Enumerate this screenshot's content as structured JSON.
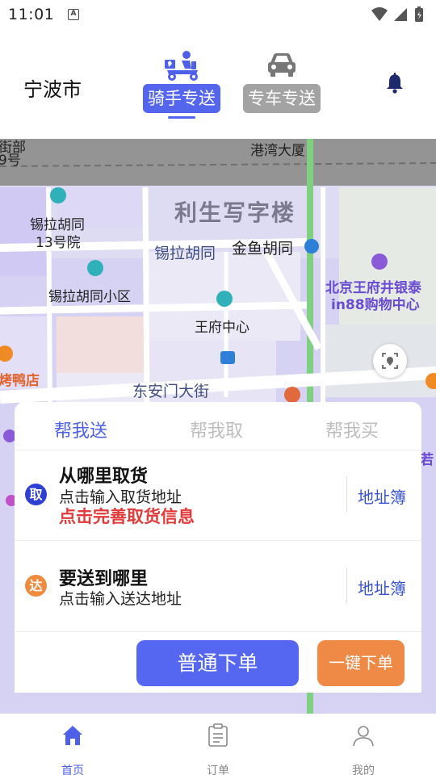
{
  "status_bar": {
    "time": "11:01"
  },
  "header": {
    "city": "宁波市",
    "modes": [
      {
        "label": "骑手专送",
        "icon": "rider-scooter-icon",
        "active": true
      },
      {
        "label": "专车专送",
        "icon": "car-icon",
        "active": false
      }
    ],
    "notification_icon": "bell-icon"
  },
  "map": {
    "labels": {
      "top_left_a": "街部",
      "top_left_b": "9号",
      "top_hotel": "港湾大厦",
      "building": "利生写字楼",
      "poi_xila13_a": "锡拉胡同",
      "poi_xila13_b": "13号院",
      "road_xila": "锡拉胡同",
      "road_jinyu": "金鱼胡同",
      "poi_xila_xiaoqu": "锡拉胡同小区",
      "poi_wangfu": "王府中心",
      "mall_a": "北京王府井银泰",
      "mall_b": "in88购物中心",
      "restaurant": "烤鸭店",
      "road_dongan": "东安门大街",
      "right_edge": "若"
    }
  },
  "order_card": {
    "tabs": [
      {
        "label": "帮我送",
        "active": true
      },
      {
        "label": "帮我取",
        "active": false
      },
      {
        "label": "帮我买",
        "active": false
      }
    ],
    "pickup": {
      "badge": "取",
      "title": "从哪里取货",
      "placeholder": "点击输入取货地址",
      "warning": "点击完善取货信息",
      "address_book": "地址簿"
    },
    "dropoff": {
      "badge": "达",
      "title": "要送到哪里",
      "placeholder": "点击输入送达地址",
      "address_book": "地址簿"
    },
    "buttons": {
      "normal_order": "普通下单",
      "quick_order": "一键下单"
    }
  },
  "bottom_nav": {
    "items": [
      {
        "label": "首页",
        "icon": "home-icon",
        "active": true
      },
      {
        "label": "订单",
        "icon": "clipboard-icon",
        "active": false
      },
      {
        "label": "我的",
        "icon": "user-icon",
        "active": false
      }
    ]
  },
  "colors": {
    "accent": "#5566f0",
    "quick": "#ee8a45",
    "warning": "#e03a3a",
    "inactive_mode": "#a3a3a3"
  }
}
